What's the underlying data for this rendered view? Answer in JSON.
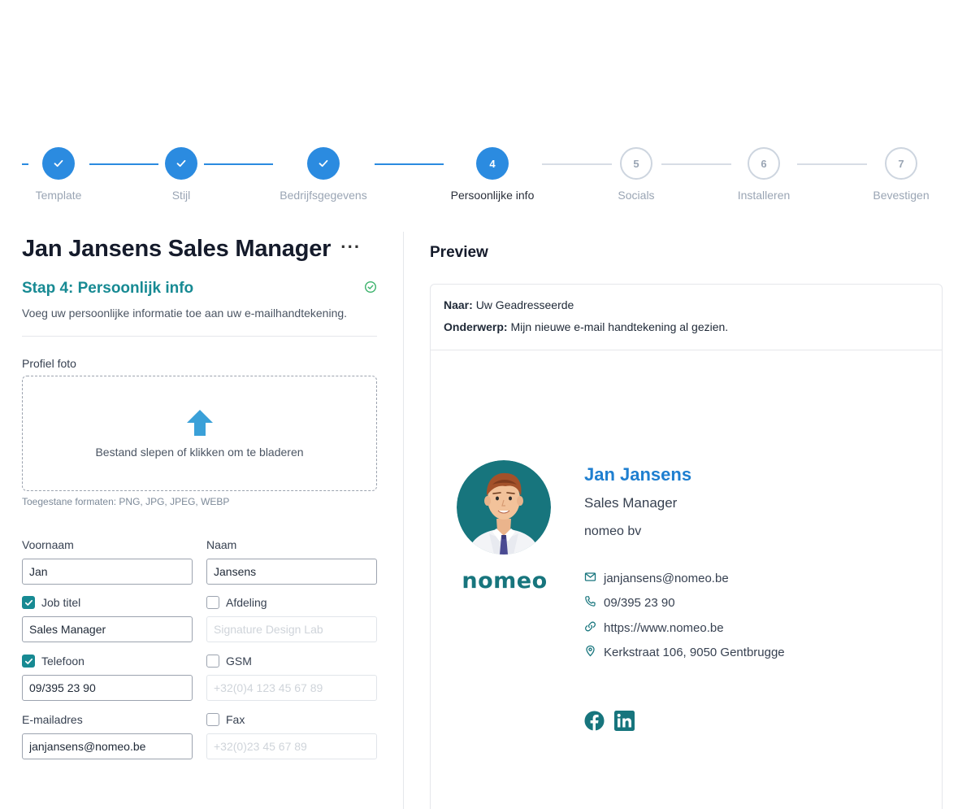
{
  "stepper": {
    "steps": [
      {
        "number": "1",
        "label": "Template",
        "state": "done"
      },
      {
        "number": "2",
        "label": "Stijl",
        "state": "done"
      },
      {
        "number": "3",
        "label": "Bedrijfsgegevens",
        "state": "done"
      },
      {
        "number": "4",
        "label": "Persoonlijke info",
        "state": "active"
      },
      {
        "number": "5",
        "label": "Socials",
        "state": "todo"
      },
      {
        "number": "6",
        "label": "Installeren",
        "state": "todo"
      },
      {
        "number": "7",
        "label": "Bevestigen",
        "state": "todo"
      }
    ]
  },
  "page": {
    "title": "Jan Jansens Sales Manager",
    "more_icon": "ellipsis-icon"
  },
  "form": {
    "step_title": "Stap 4: Persoonlijk info",
    "step_desc": "Voeg uw persoonlijke informatie toe aan uw e-mailhandtekening.",
    "profile_label": "Profiel foto",
    "dropzone_text": "Bestand slepen of klikken om te bladeren",
    "formats": "Toegestane formaten: PNG, JPG, JPEG, WEBP",
    "first_name": {
      "label": "Voornaam",
      "value": "Jan"
    },
    "last_name": {
      "label": "Naam",
      "value": "Jansens"
    },
    "job_title": {
      "label": "Job titel",
      "checked": true,
      "value": "Sales Manager"
    },
    "department": {
      "label": "Afdeling",
      "checked": false,
      "placeholder": "Signature Design Lab"
    },
    "phone": {
      "label": "Telefoon",
      "checked": true,
      "value": "09/395 23 90"
    },
    "mobile": {
      "label": "GSM",
      "checked": false,
      "placeholder": "+32(0)4 123 45 67 89"
    },
    "email": {
      "label": "E-mailadres",
      "value": "janjansens@nomeo.be"
    },
    "fax": {
      "label": "Fax",
      "checked": false,
      "placeholder": "+32(0)23 45 67 89"
    }
  },
  "preview": {
    "title": "Preview",
    "to_label": "Naar:",
    "to_value": "Uw Geadresseerde",
    "subject_label": "Onderwerp:",
    "subject_value": "Mijn nieuwe e-mail handtekening al gezien.",
    "signature": {
      "name": "Jan Jansens",
      "job": "Sales Manager",
      "company": "nomeo bv",
      "brand": "nomeo",
      "email": "janjansens@nomeo.be",
      "phone": "09/395 23 90",
      "website": "https://www.nomeo.be",
      "address": "Kerkstraat 106, 9050 Gentbrugge",
      "socials": [
        "facebook-icon",
        "linkedin-icon"
      ]
    }
  },
  "colors": {
    "accent_blue": "#2b8be0",
    "teal": "#178a93",
    "signature_name": "#1f7fd0",
    "icon_teal": "#17757d"
  }
}
